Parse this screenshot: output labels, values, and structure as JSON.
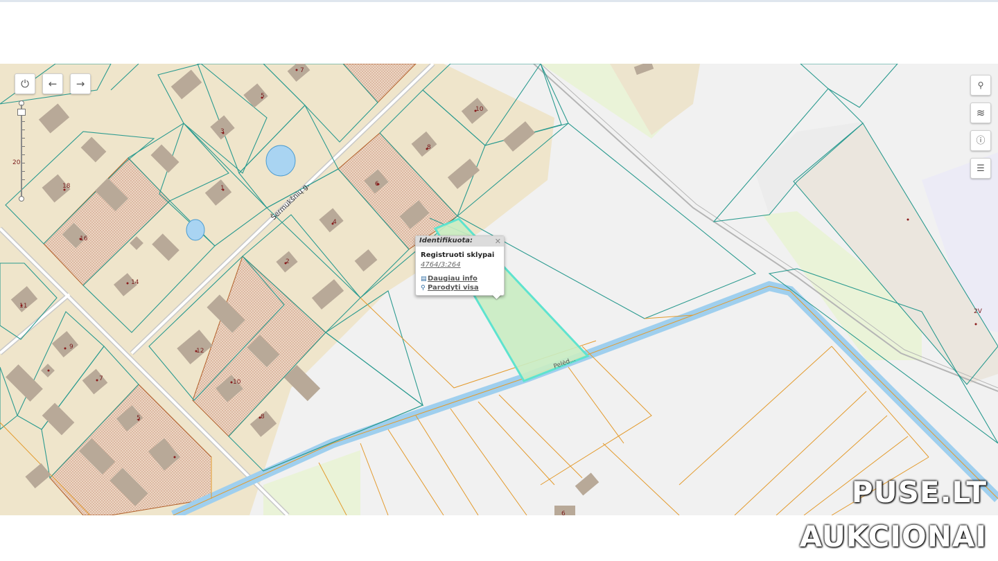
{
  "map": {
    "street_label": "Šermukšnių g.",
    "canal_label": "Pelėd...",
    "parcel_numbers": [
      "7",
      "5",
      "3",
      "1",
      "10",
      "8",
      "6",
      "4",
      "2",
      "18",
      "16",
      "14",
      "12",
      "10",
      "8",
      "11",
      "9",
      "7",
      "5",
      "20",
      "2V",
      "6"
    ]
  },
  "controls": {
    "power_icon": "power-icon",
    "back_icon": "arrow-left-icon",
    "forward_icon": "arrow-right-icon",
    "search_icon": "search-icon",
    "layers_icon": "layers-icon",
    "info_icon": "info-icon",
    "legend_icon": "legend-icon"
  },
  "popup": {
    "title": "Identifikuota:",
    "layer": "Registruoti sklypai",
    "parcel_id": "4764/3:264",
    "more_info": "Daugiau info",
    "show_all": "Parodyti visa"
  },
  "watermark": {
    "line1": "PUSE.LT",
    "line2": "AUKCIONAI"
  },
  "colors": {
    "selected_parcel": "#c9ecc2",
    "selected_outline": "#5ee3cf",
    "canal": "#a9d3f0",
    "parcel_outline": "#2a9a8f",
    "cadastre_outline": "#e39a2c",
    "house_yard": "#efe4c8"
  }
}
